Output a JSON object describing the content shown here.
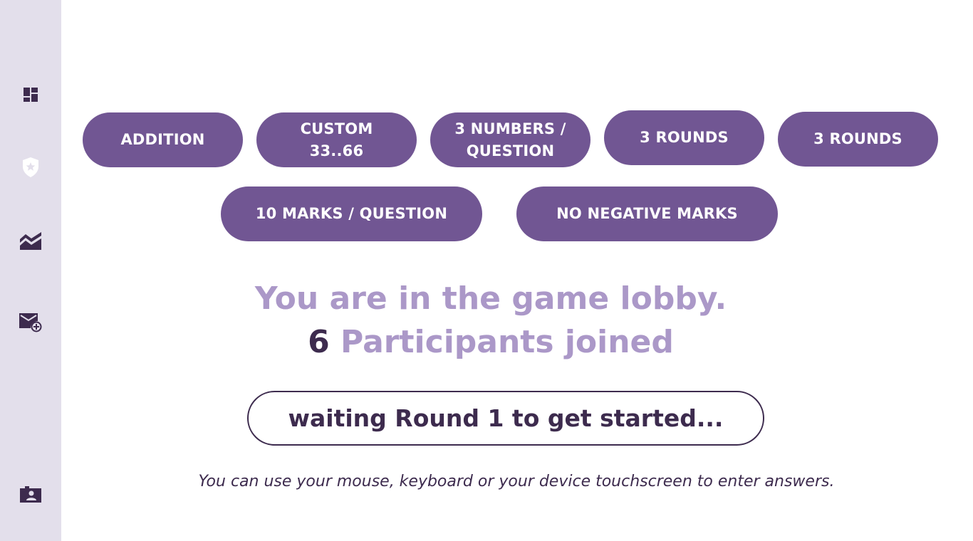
{
  "sidebar": {
    "items": [
      {
        "icon": "dashboard-icon"
      },
      {
        "icon": "badge-star-icon"
      },
      {
        "icon": "chart-area-icon"
      },
      {
        "icon": "mail-add-icon"
      },
      {
        "icon": "contact-folder-icon"
      }
    ]
  },
  "settings": {
    "operation": "ADDITION",
    "range": "CUSTOM 33..66",
    "numbers_per_question": "3 NUMBERS / QUESTION",
    "rounds": "3 ROUNDS",
    "rounds_repeat": "3 ROUNDS",
    "marks": "10 MARKS / QUESTION",
    "negative_marks": "NO NEGATIVE MARKS"
  },
  "lobby": {
    "title": "You are in the game lobby.",
    "participant_count": "6",
    "participants_label": "Participants joined",
    "status": "waiting Round 1 to get started...",
    "hint": "You can use your mouse, keyboard or your device touchscreen to enter answers."
  },
  "colors": {
    "accent": "#715693",
    "accent_light": "#ab98c8",
    "dark": "#3d2b4e",
    "sidebar_bg": "#e3dfeb"
  }
}
